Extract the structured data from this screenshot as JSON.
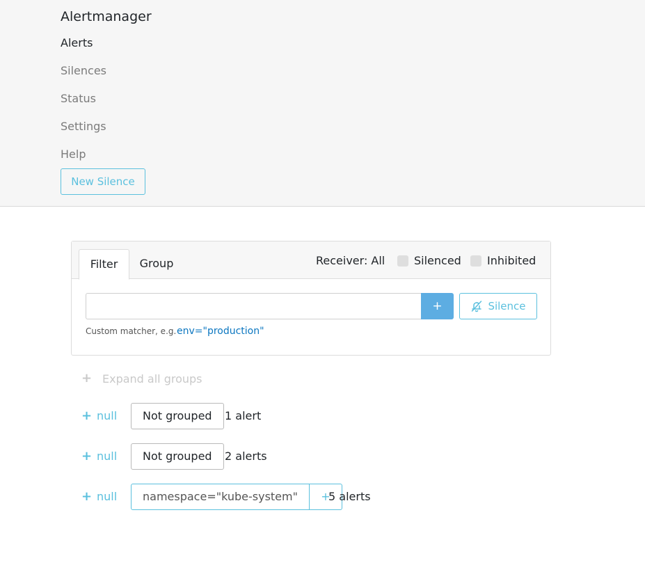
{
  "header": {
    "brand": "Alertmanager",
    "nav": [
      {
        "label": "Alerts",
        "active": true
      },
      {
        "label": "Silences",
        "active": false
      },
      {
        "label": "Status",
        "active": false
      },
      {
        "label": "Settings",
        "active": false
      },
      {
        "label": "Help",
        "active": false
      }
    ],
    "new_silence_label": "New Silence"
  },
  "filter_card": {
    "tabs": [
      {
        "label": "Filter",
        "active": true
      },
      {
        "label": "Group",
        "active": false
      }
    ],
    "receiver_label": "Receiver: All",
    "silenced_label": "Silenced",
    "silenced_checked": false,
    "inhibited_label": "Inhibited",
    "inhibited_checked": false,
    "input_value": "",
    "input_placeholder": "",
    "add_button_label": "+",
    "silence_button_label": "Silence",
    "silence_button_icon": "bell-slash-icon",
    "hint_text": "Custom matcher, e.g.",
    "hint_example": "env=\"production\""
  },
  "groups": {
    "expand_all_label": "Expand all groups",
    "items": [
      {
        "toggle_label": "null",
        "group_label": "Not grouped",
        "count_label": "1 alert"
      },
      {
        "toggle_label": "null",
        "group_label": "Not grouped",
        "count_label": "2 alerts"
      },
      {
        "toggle_label": "null",
        "group_label": "namespace=\"kube-system\"",
        "group_add_label": "+",
        "count_label": "5 alerts"
      }
    ]
  },
  "colors": {
    "header_bg": "#f6f6f6",
    "accent": "#5bc0de",
    "primary_button": "#5dade2",
    "link_example": "#0b76c0",
    "muted_text": "#7b7b7b"
  }
}
